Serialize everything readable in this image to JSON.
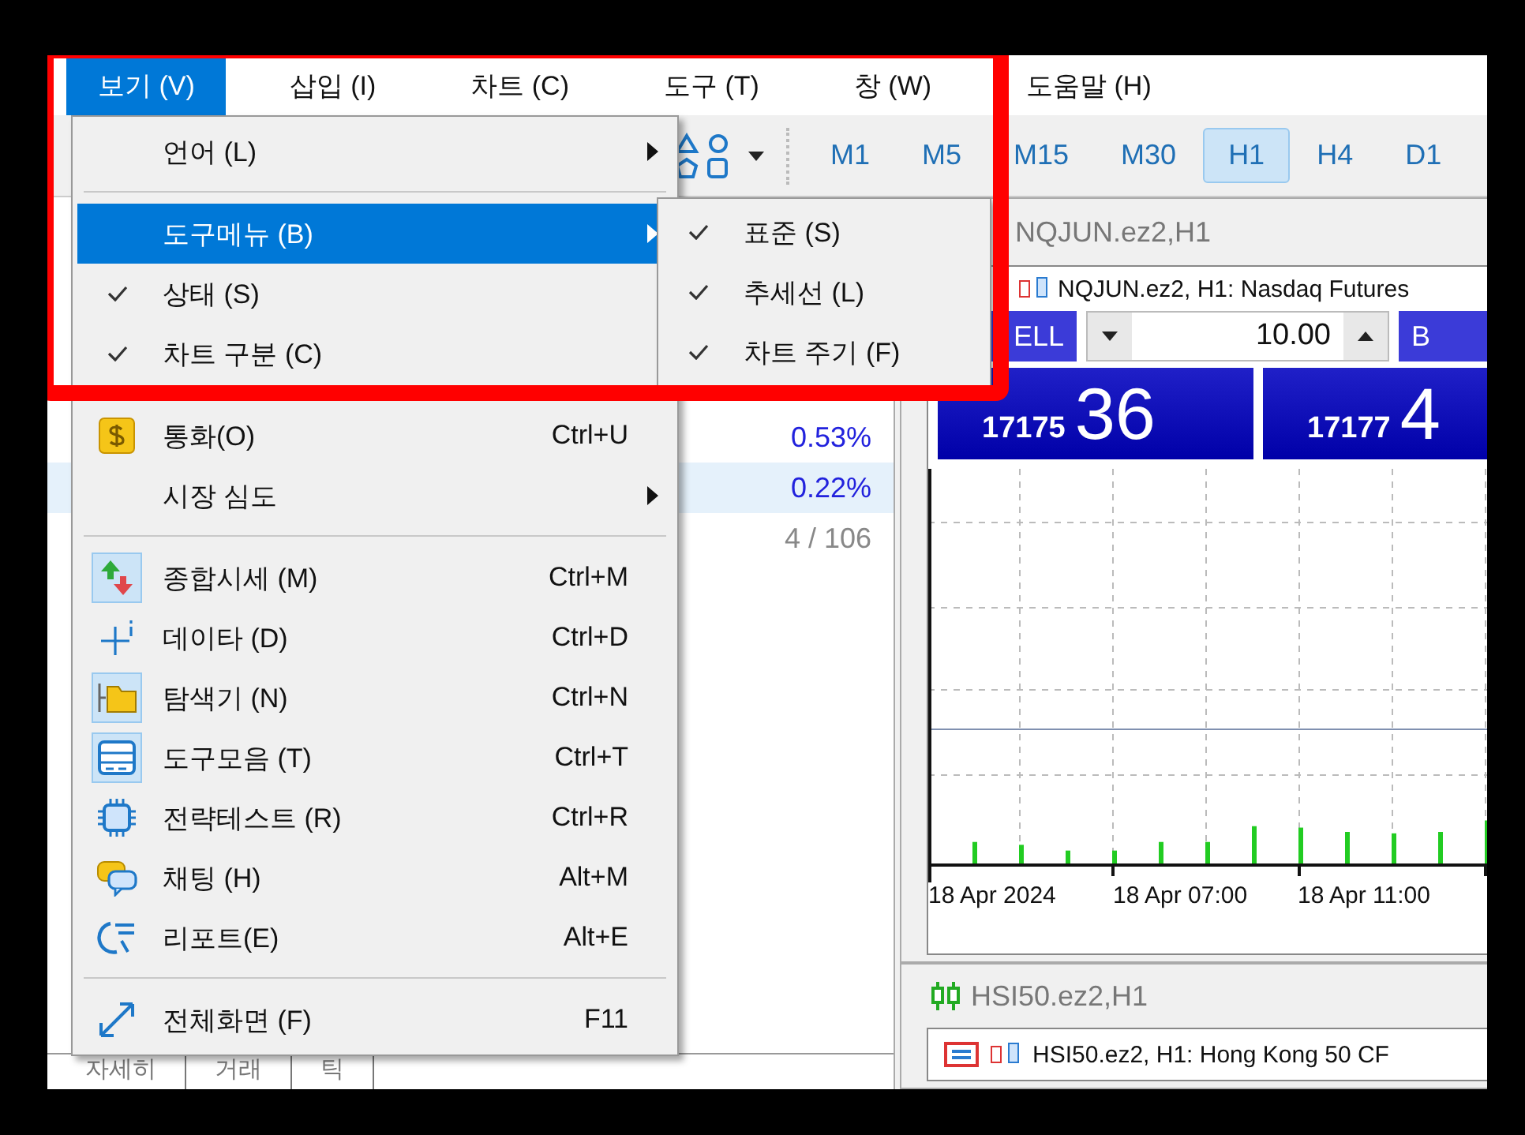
{
  "menubar": [
    {
      "label": "보기 (V)",
      "selected": true
    },
    {
      "label": "삽입 (I)",
      "selected": false
    },
    {
      "label": "차트 (C)",
      "selected": false
    },
    {
      "label": "도구 (T)",
      "selected": false
    },
    {
      "label": "창 (W)",
      "selected": false
    },
    {
      "label": "도움말 (H)",
      "selected": false
    }
  ],
  "view_menu": {
    "items": [
      {
        "kind": "submenu",
        "label": "언어 (L)",
        "checked": false,
        "selected": false
      },
      {
        "kind": "separator"
      },
      {
        "kind": "submenu",
        "label": "도구메뉴 (B)",
        "checked": false,
        "selected": true
      },
      {
        "kind": "check",
        "label": "상태 (S)",
        "checked": true,
        "selected": false
      },
      {
        "kind": "check",
        "label": "차트 구분 (C)",
        "checked": true,
        "selected": false
      },
      {
        "kind": "separator"
      },
      {
        "kind": "command",
        "label": "통화(O)",
        "shortcut": "Ctrl+U",
        "checked": false,
        "selected": false
      },
      {
        "kind": "submenu",
        "label": "시장 심도",
        "checked": false,
        "selected": false
      },
      {
        "kind": "separator"
      },
      {
        "kind": "command",
        "label": "종합시세 (M)",
        "shortcut": "Ctrl+M",
        "checked": true,
        "selected": false
      },
      {
        "kind": "command",
        "label": "데이타 (D)",
        "shortcut": "Ctrl+D",
        "checked": false,
        "selected": false
      },
      {
        "kind": "command",
        "label": "탐색기 (N)",
        "shortcut": "Ctrl+N",
        "checked": true,
        "selected": false
      },
      {
        "kind": "command",
        "label": "도구모음 (T)",
        "shortcut": "Ctrl+T",
        "checked": true,
        "selected": false
      },
      {
        "kind": "command",
        "label": "전략테스트 (R)",
        "shortcut": "Ctrl+R",
        "checked": false,
        "selected": false
      },
      {
        "kind": "command",
        "label": "채팅 (H)",
        "shortcut": "Alt+M",
        "checked": false,
        "selected": false
      },
      {
        "kind": "command",
        "label": "리포트(E)",
        "shortcut": "Alt+E",
        "checked": false,
        "selected": false
      },
      {
        "kind": "separator"
      },
      {
        "kind": "command",
        "label": "전체화면 (F)",
        "shortcut": "F11",
        "checked": false,
        "selected": false
      }
    ]
  },
  "toolbar_submenu": {
    "items": [
      {
        "label": "표준 (S)",
        "checked": true
      },
      {
        "label": "추세선 (L)",
        "checked": true
      },
      {
        "label": "차트 주기 (F)",
        "checked": true
      }
    ]
  },
  "timeframes": [
    {
      "label": "M1",
      "selected": false
    },
    {
      "label": "M5",
      "selected": false
    },
    {
      "label": "M15",
      "selected": false
    },
    {
      "label": "M30",
      "selected": false
    },
    {
      "label": "H1",
      "selected": true
    },
    {
      "label": "H4",
      "selected": false
    },
    {
      "label": "D1",
      "selected": false
    }
  ],
  "market_watch": {
    "rows": [
      {
        "value": "0.53%",
        "selected": false
      },
      {
        "value": "0.22%",
        "selected": true
      }
    ],
    "count": "4 / 106",
    "tabs": [
      "자세히",
      "거래",
      "틱"
    ]
  },
  "chart_windows": [
    {
      "title": "NQJUN.ez2,H1",
      "header": "NQJUN.ez2, H1: Nasdaq Futures",
      "trade_panel": {
        "sell_label": "ELL",
        "lot": "10.00",
        "buy_label": "B",
        "bid_prefix": "17175",
        "bid_big": "36",
        "ask_prefix": "17177",
        "ask_big": "4"
      },
      "time_labels": [
        "18 Apr 2024",
        "18 Apr 07:00",
        "18 Apr 11:00"
      ]
    },
    {
      "title": "HSI50.ez2,H1",
      "header": "HSI50.ez2, H1: Hong Kong 50 CF"
    }
  ]
}
